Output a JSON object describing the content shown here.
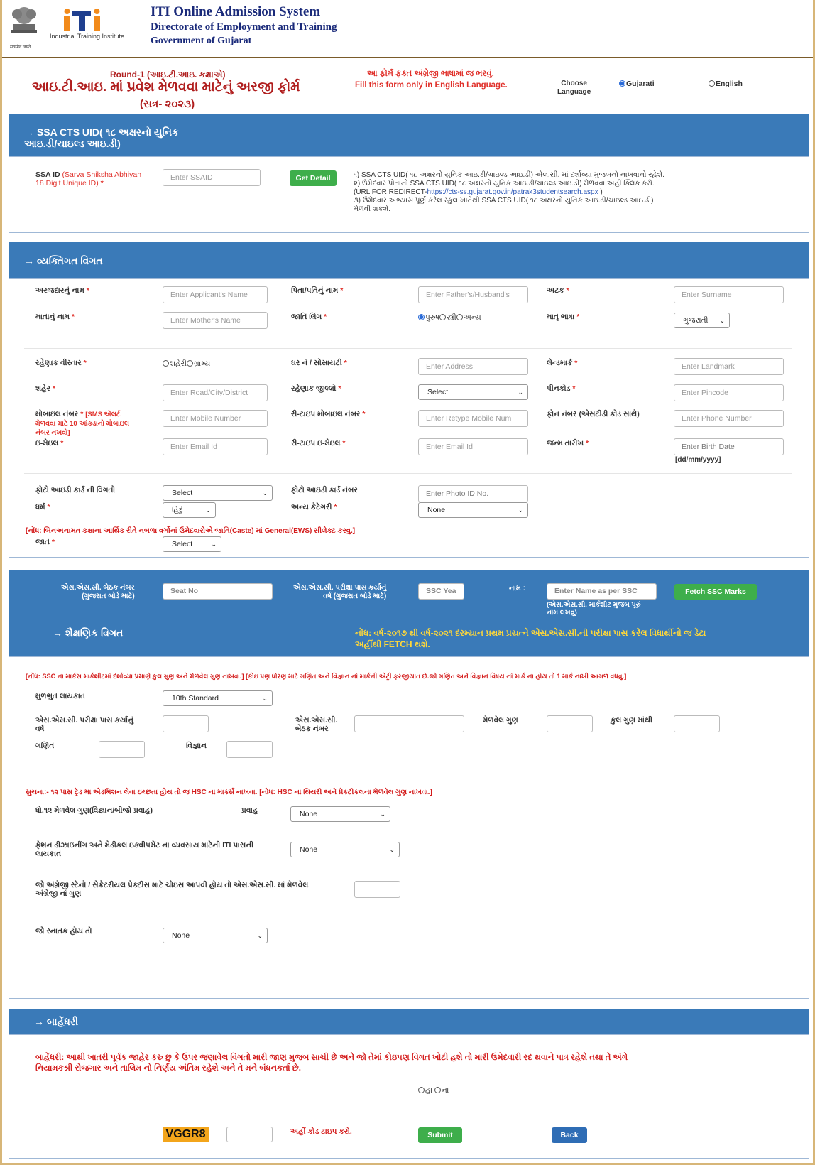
{
  "header": {
    "logo_caption": "सत्यमेव जयते",
    "iti_logo_caption": "Industrial Training Institute",
    "title1": "ITI Online Admission System",
    "title2": "Directorate of Employment and Training",
    "title3": "Government of Gujarat"
  },
  "form_head": {
    "round": "Round-1 (આઇ.ટી.આઇ. કક્ષાએ)",
    "title": "આઇ.ટી.આઇ. માં પ્રવેશ મેળવવા માટેનું અરજી ફોર્મ",
    "session": "(સત્ર- ૨૦૨૩)",
    "warn_guj": "આ ફોર્મ ફક્ત અંગ્રેજી ભાષામાં જ ભરવું.",
    "warn_en": "Fill this form only in English Language.",
    "choose_language": "Choose\nLanguage",
    "lang_gujarati": "Gujarati",
    "lang_english": "English"
  },
  "ssa": {
    "band_title": "→ SSA CTS UID( ૧૮ અક્ષરનો યુનિક\nઆઇ.ડી/ચાઇલ્ડ આઇ.ડી)",
    "label": "SSA ID",
    "label_red": "(Sarva Shiksha Abhiyan\n18 Digit Unique ID)",
    "star": "*",
    "placeholder": "Enter SSAID",
    "get_detail": "Get Detail",
    "info1": "૧) SSA CTS UID( ૧૮ અક્ષરનો યુનિક આઇ.ડી/ચાઇલ્ડ આઇ.ડી) એલ.સી. માં દર્શાવ્યા મુજબનો નાખવાનો રહેશે.",
    "info2": "૨) ઉમેદવાર પોતાનો SSA CTS UID( ૧૮ અક્ષરનો યુનિક આઇ.ડી/ચાઇલ્ડ આઇ.ડી) મેળવવા અહીં ક્લિક કરો.",
    "info3_prefix": "(URL FOR REDIRECT-",
    "info3_link": "https://cts-ss.gujarat.gov.in/patrak3studentsearch.aspx",
    "info3_suffix": " )",
    "info4": "૩) ઉમેદવાર અભ્યાસ પૂર્ણ કરેલ સ્કુલ ખાતેથી SSA CTS UID( ૧૮ અક્ષરનો યુનિક આઇ.ડી/ચાઇલ્ડ આઇ.ડી)\nમેળવી શકશે."
  },
  "personal": {
    "band_title": "→ વ્યક્તિગત વિગત",
    "applicant_name": "અરજદારનું નામ",
    "applicant_ph": "Enter Applicant's Name",
    "father_name": "પિતા/પતિનું નામ",
    "father_ph": "Enter Father's/Husband's",
    "surname": "અટક",
    "surname_ph": "Enter Surname",
    "mother_name": "માતાનું નામ",
    "mother_ph": "Enter Mother's Name",
    "gender": "જાતિ લિંગ",
    "gender_male": "પુરુષ",
    "gender_female": "સ્ત્રી",
    "gender_other": "અન્ય",
    "mother_tongue": "માતૃ ભાષા",
    "mother_tongue_val": "ગુજરાતી",
    "area": "રહેણાક વીસ્તાર",
    "area_urban": "શહેરી",
    "area_rural": "ગ્રામ્ય",
    "house": "ઘર નં / સોસાયટી",
    "address_ph": "Enter Address",
    "landmark": "લેન્ડમાર્ક",
    "landmark_ph": "Enter Landmark",
    "city": "શહેર",
    "city_ph": "Enter Road/City/District",
    "district": "રહેણાક જીલ્લો",
    "district_val": "Select",
    "pincode": "પીનકોડ",
    "pincode_ph": "Enter Pincode",
    "mobile": "મોબાઇલ નંબર",
    "mobile_note": "[SMS એલર્ટ\nમેળવવા માટે 10 આંકડાનો મોબાઇલ\nનંબર નખવો]",
    "mobile_ph": "Enter Mobile Number",
    "retype_mobile": "રી-ટાઇપ મોબાઇલ નંબર",
    "retype_mobile_ph": "Enter Retype Mobile Num",
    "phone": "ફોન નંબર (એસટીડી કોડ સાથે)",
    "phone_ph": "Enter Phone Number",
    "email": "ઇ-મેઇલ",
    "email_ph": "Enter Email Id",
    "retype_email": "રી-ટાઇપ ઇ-મેઇલ",
    "retype_email_ph": "Enter Email Id",
    "dob": "જન્મ તારીખ",
    "dob_ph": "Enter Birth Date",
    "dob_format": "[dd/mm/yyyy]",
    "photo_id": "ફોટો આઇડી કાર્ડ ની વિગતો",
    "photo_id_val": "Select",
    "photo_id_no": "ફોટો આઇડી કાર્ડ નંબર",
    "photo_id_no_ph": "Enter Photo ID No.",
    "religion": "ધર્મ",
    "religion_val": "હિંદુ",
    "other_category": "અન્ય કેટેગરી",
    "other_category_val": "None",
    "ews_note": "[નોંધ: બિનઅનામત કક્ષાના આર્થિક રીતે નબળા વર્ગોનાં ઉમેદવારોએ જાતિ(Caste) માં General(EWS) સીલેક્ટ કરવુ.]",
    "caste": "જાત",
    "caste_val": "Select",
    "star": "*"
  },
  "ssc_band": {
    "seat_label": "એસ.એસ.સી. બેઠક નંબર\n(ગુજરાત બોર્ડ માટે)",
    "seat_ph": "Seat No",
    "year_label": "એસ.એસ.સી. પરીક્ષા પાસ કર્યાનું\nવર્ષ (ગુજરાત બોર્ડ માટે)",
    "year_ph": "SSC Yea",
    "name_label": "નામ :",
    "name_ph": "Enter Name as per SSC",
    "name_note": "(એસ.એસ.સી. માર્કશીટ મુજબ પૂરું\nનામ લખવુ)",
    "fetch": "Fetch SSC Marks",
    "edu_title": "→ શૈક્ષણિક વિગત",
    "yellow_note": "નોંધ: વર્ષ-૨૦૧૭ થી વર્ષ-૨૦૨૧ દરમ્યાન પ્રથમ પ્રયત્ને એસ.એસ.સી.ની પરીક્ષા પાસ કરેલ વિધાર્થીનો જ ડેટા\nઅહીંથી FETCH થશે."
  },
  "education": {
    "marks_note": "[નોંધ: SSC ના માર્કસ માર્કશીટમાં દર્શાવ્યા પ્રમાણે કુલ ગુણ અને મેળવેલ ગુણ નાખવા.] [કોઇ પણ ધોરણ માટે ગણિત અને વિજ્ઞાન નાં માર્કની એંટ્રી ફરજીયાત છે.જો ગણિત અને વિજ્ઞાન વિષય નાં માર્ક ના હોય તો 1 માર્ક નાખી આગળ વધવુ.]",
    "basic_qual": "મુળભુત લાયકાત",
    "basic_qual_val": "10th Standard",
    "ssc_year": "એસ.એસ.સી. પરીક્ષા પાસ કર્યાનું\nવર્ષ",
    "ssc_seat": "એસ.એસ.સી.\nબેઠક નંબર",
    "obtained": "મેળવેલ ગુણ",
    "total": "કુલ ગુણ માંથી",
    "maths": "ગણિત",
    "science": "વિજ્ઞાન",
    "hsc_note": "સુચના:- ૧૨ પાસ ટ્રેડ મા એડમિશન લેવા ઇચ્છતા હોય તો જ HSC ના માર્ક્સ નાખવા. [નોંધ: HSC ના થિયરી અને પ્રેક્ટીકલના મેળવેલ ગુણ નાખવા.]",
    "std12": "ધો.૧૨ મેળવેલ ગુણ(વિજ્ઞાન/બીજો પ્રવાહ)",
    "stream": "પ્રવાહ",
    "stream_val": "None",
    "fashion": "ફેશન ડીઝાઇનીંગ અને મેડીકલ ઇક્વીપમેંટ ના વ્યવસાય માટેની ITI પાસની\nલાયકાત",
    "fashion_val": "None",
    "english": "જો અંગ્રેજી સ્ટેનો / સેક્રેટરીયલ પ્રેક્ટીસ માટે ચોઇસ આપવી હોય તો એસ.એસ.સી. માં મેળવેલ\nઅંગ્રેજી નાં ગુણ",
    "graduate": "જો સ્નાતક હોય તો",
    "graduate_val": "None"
  },
  "declaration": {
    "band_title": "→ બાહેંધરી",
    "text": "બાહેંધરી: આથી ખાતરી પૂર્વક જાહેર કરુ છુ કે ઉપર જણાવેલ વિગતો મારી જાણ મુજબ સાચી છે અને જો તેમાં કોઇપણ વિગત ખોટી હશે તો મારી ઉમેદવારી રદ થવાને પાત્ર રહેશે તથા તે અંગે\nનિયામકશ્રી રોજગાર અને તાલિમ નો નિર્ણય અંતિમ રહેશે અને તે મને બંધનકર્તા છે.",
    "yes": "હા",
    "no": "ના",
    "captcha": "VGGR8",
    "captcha_hint": "અહીં કોડ ટાઇપ કરો.",
    "submit": "Submit",
    "back": "Back"
  },
  "colors": {
    "band": "#3a7ab8",
    "accent_red": "#e0302a",
    "yellow": "#ffd83a",
    "green": "#3eae4b",
    "blue": "#2f6db5",
    "frame": "#d7b678"
  }
}
